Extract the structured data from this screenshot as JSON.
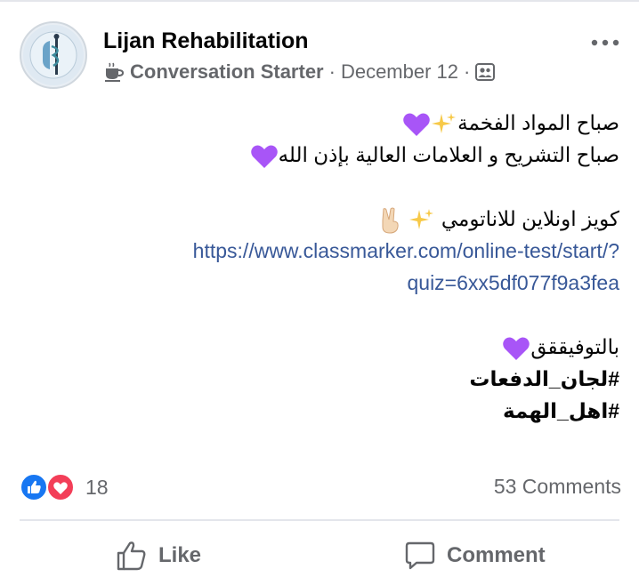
{
  "header": {
    "page_name": "Lijan Rehabilitation",
    "badge_label": "Conversation Starter",
    "separator": "·",
    "date": "December 12",
    "badge_icon": "coffee-cup-icon",
    "audience_icon": "group-icon",
    "more_icon": "more-horizontal-icon"
  },
  "post": {
    "line1": "صباح المواد الفخمة",
    "line2": "صباح التشريح و العلامات العالية بإذن الله",
    "line3": "كويز اونلاين للاناتومي",
    "link_line1": "https://www.classmarker.com/online-test/start/?",
    "link_line2": "quiz=6xx5df077f9a3fea",
    "line4": "بالتوفيققق",
    "hashtag1": "#لجان_الدفعات",
    "hashtag2": "#اهل_الهمة"
  },
  "stats": {
    "reaction_count": "18",
    "comments": "53 Comments"
  },
  "actions": {
    "like_label": "Like",
    "comment_label": "Comment"
  },
  "colors": {
    "link": "#385898",
    "like_blue": "#1877f2",
    "love_red": "#f33e58",
    "purple_heart": "#a855f7",
    "muted": "#65676b"
  }
}
